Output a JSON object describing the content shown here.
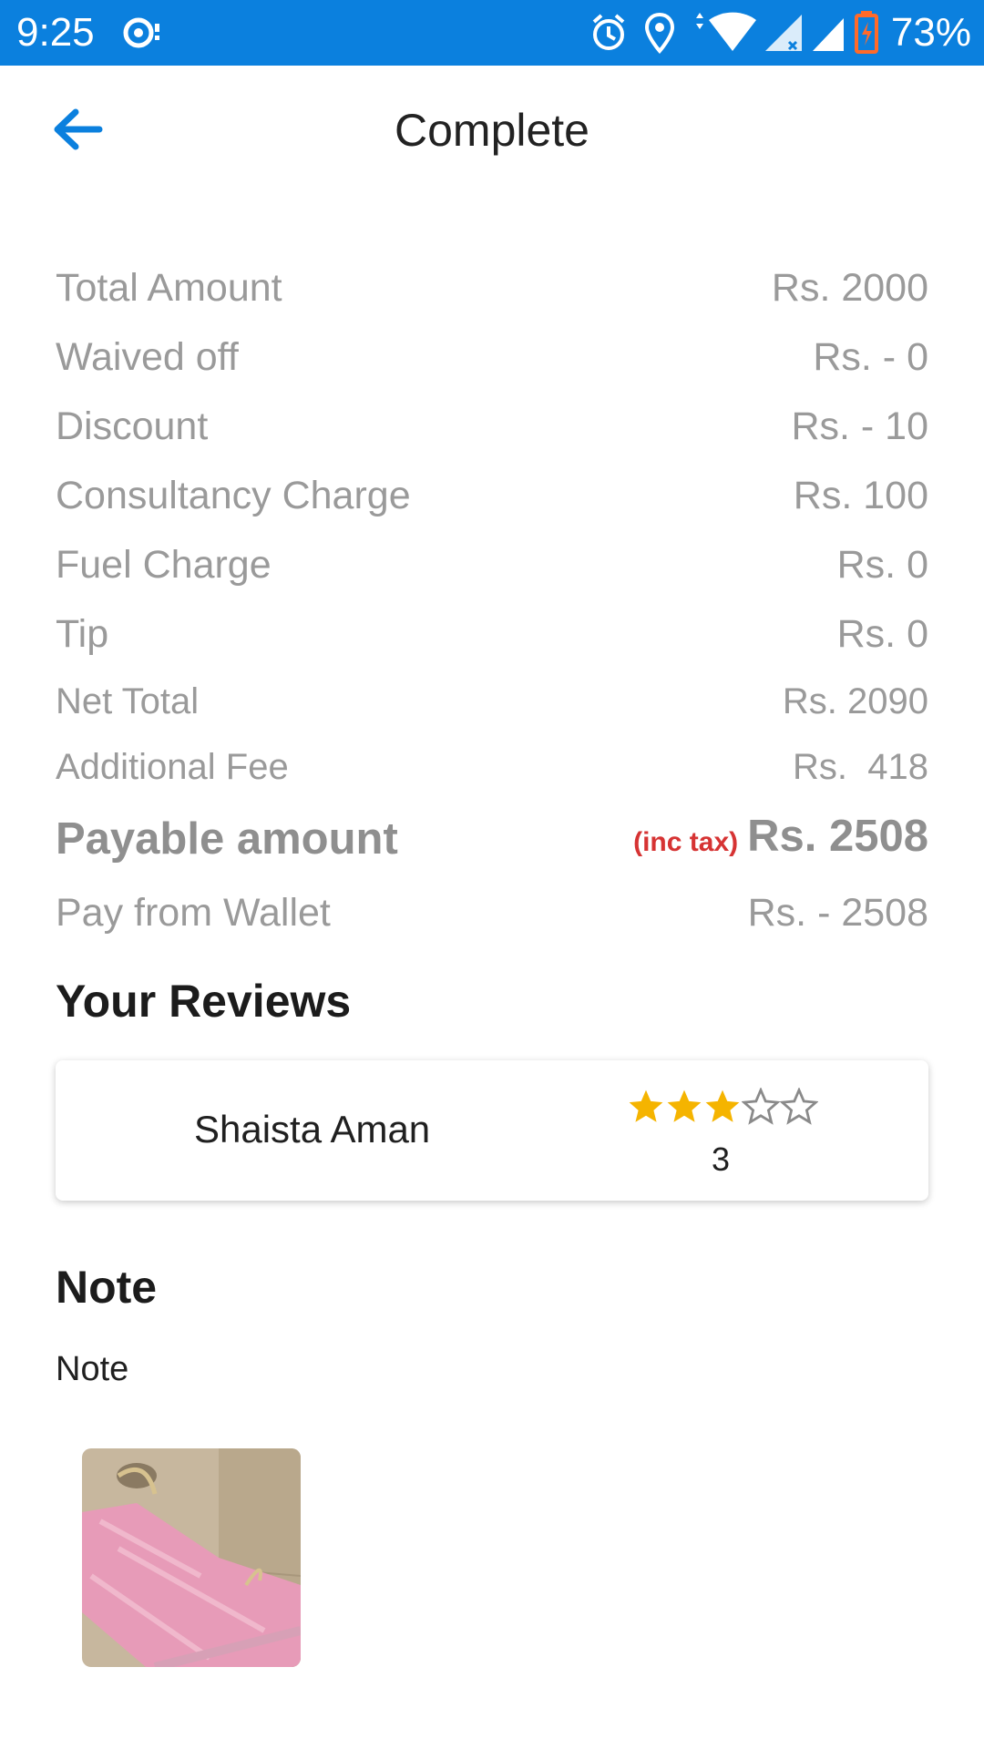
{
  "status_bar": {
    "time": "9:25",
    "battery_percent": "73%",
    "background_color": "#0b80de",
    "icons": [
      "notification-icon",
      "alarm-icon",
      "location-icon",
      "wifi-icon",
      "signal-icon",
      "battery-charging-icon"
    ]
  },
  "app_bar": {
    "title": "Complete",
    "back_icon": "arrow-left-icon",
    "accent_color": "#0b80de"
  },
  "bill": {
    "rows": [
      {
        "label": "Total Amount",
        "value": "Rs. 2000"
      },
      {
        "label": "Waived off",
        "value": "Rs. - 0"
      },
      {
        "label": "Discount",
        "value": "Rs. - 10"
      },
      {
        "label": "Consultancy Charge",
        "value": "Rs. 100"
      },
      {
        "label": "Fuel Charge",
        "value": "Rs. 0"
      },
      {
        "label": "Tip",
        "value": "Rs. 0"
      },
      {
        "label": "Net Total",
        "value": "Rs. 2090"
      },
      {
        "label": "Additional Fee",
        "value": "Rs.  418"
      }
    ],
    "payable": {
      "label": "Payable amount",
      "tax_note": "(inc tax)",
      "value": "Rs. 2508"
    },
    "wallet": {
      "label": "Pay from Wallet",
      "value": "Rs. - 2508"
    }
  },
  "reviews": {
    "title": "Your Reviews",
    "items": [
      {
        "name": "Shaista Aman",
        "rating": 3,
        "max_rating": 5,
        "rating_text": "3",
        "star_color": "#f5b400"
      }
    ]
  },
  "note": {
    "title": "Note",
    "text": "Note",
    "photo_icon": "photo-thumbnail"
  }
}
